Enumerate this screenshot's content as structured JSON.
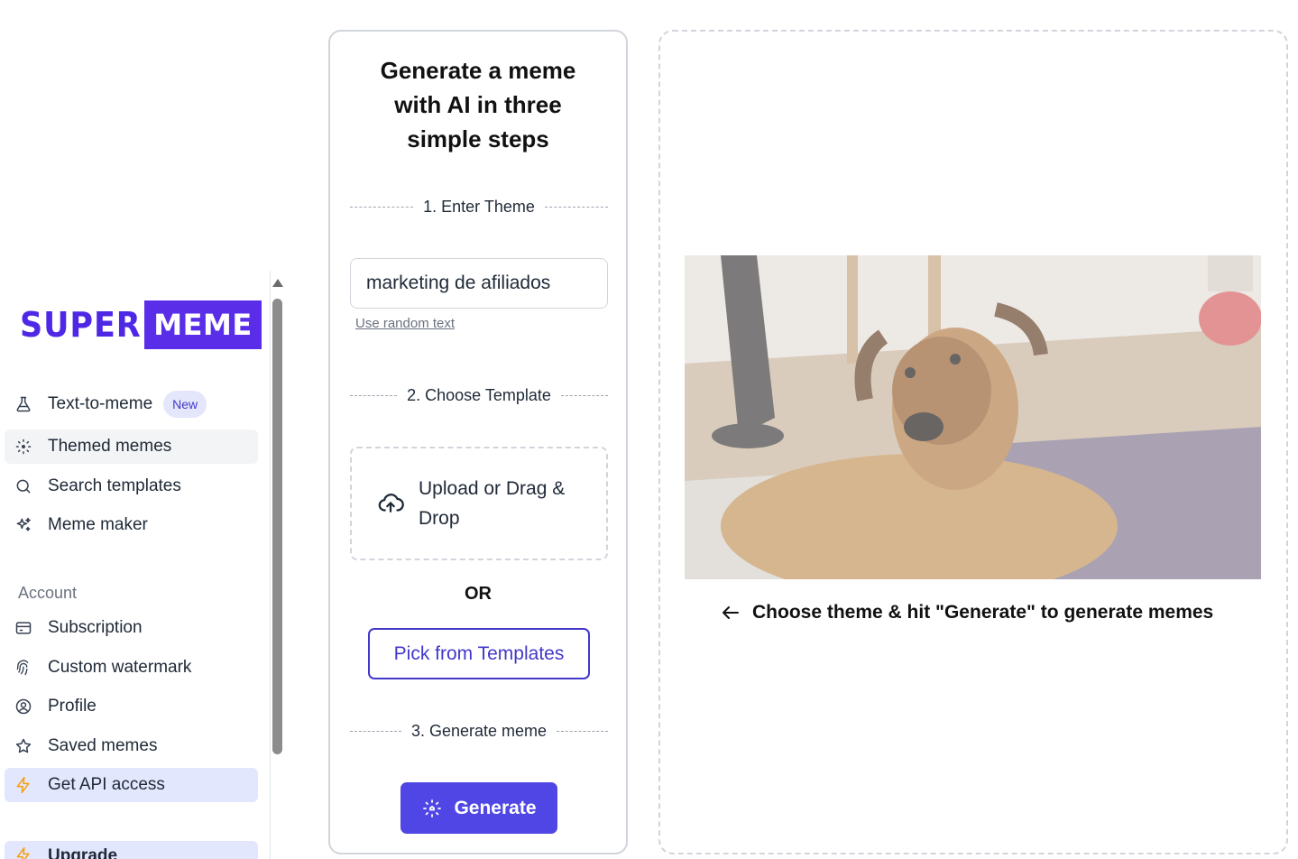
{
  "brand": {
    "part1": "SUPER",
    "part2": "MEME",
    "accent": "#5a2ee8"
  },
  "sidebar": {
    "items": [
      {
        "label": "Text-to-meme",
        "icon": "flask-icon",
        "badge": "New"
      },
      {
        "label": "Themed memes",
        "icon": "dashed-ai-icon"
      },
      {
        "label": "Search templates",
        "icon": "search-icon"
      },
      {
        "label": "Meme maker",
        "icon": "sparkles-icon"
      }
    ],
    "account_label": "Account",
    "account_items": [
      {
        "label": "Subscription",
        "icon": "credit-card-icon"
      },
      {
        "label": "Custom watermark",
        "icon": "fingerprint-icon"
      },
      {
        "label": "Profile",
        "icon": "user-circle-icon"
      },
      {
        "label": "Saved memes",
        "icon": "star-icon"
      },
      {
        "label": "Get API access",
        "icon": "lightning-icon"
      }
    ],
    "bottom_item": {
      "label": "Upgrade",
      "icon": "lightning-icon"
    }
  },
  "generator": {
    "title": "Generate a meme with AI in three simple steps",
    "step1": "1. Enter Theme",
    "theme_value": "marketing de afiliados",
    "random_link": "Use random text",
    "step2": "2. Choose Template",
    "upload_text": "Upload or Drag & Drop",
    "or_text": "OR",
    "pick_button": "Pick from Templates",
    "step3": "3. Generate meme",
    "generate_button": "Generate"
  },
  "result": {
    "hint": "Choose theme & hit \"Generate\" to generate memes",
    "image_alt": "dog lying on floor"
  }
}
